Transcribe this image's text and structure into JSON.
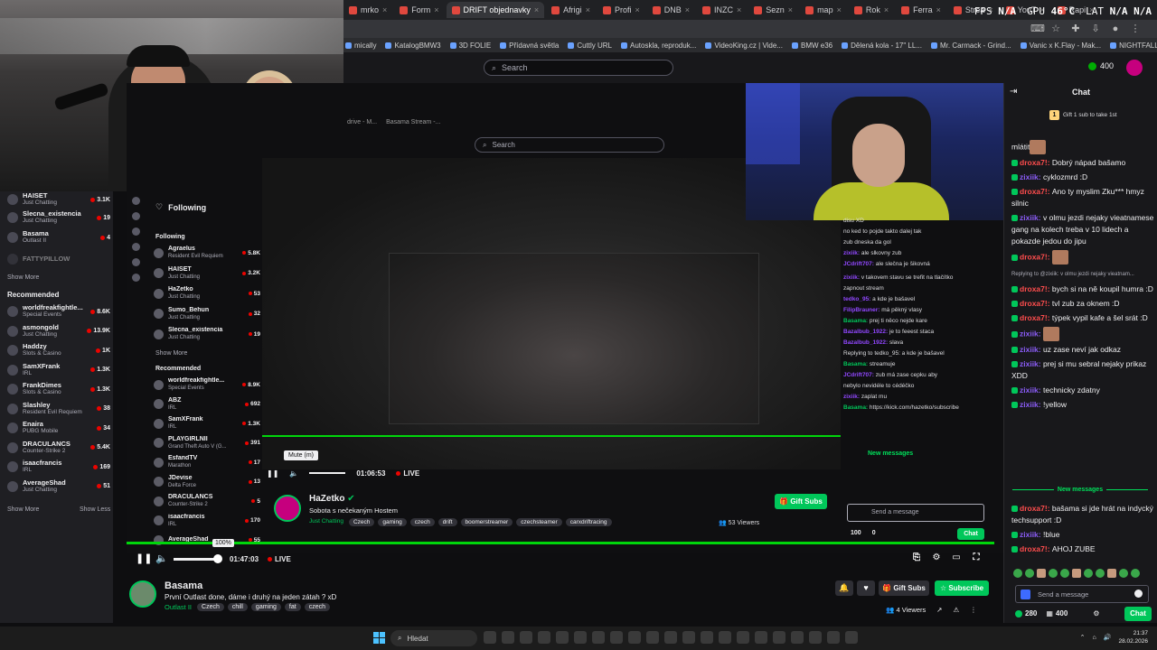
{
  "browser": {
    "tabs": [
      "mrko",
      "Form",
      "DRIFT objednavky",
      "Afrigi",
      "Profi",
      "DNB",
      "INZC",
      "Sezn",
      "map",
      "Rok",
      "Ferra",
      "Strea",
      "YouT",
      "Rapi"
    ],
    "active_tab_index": 2,
    "bookmarks": [
      "mically",
      "KatalogBMW3",
      "3D FOLIE",
      "Přídavná světla",
      "Cuttly URL",
      "Autoskla, reproduk...",
      "VideoKing.cz | Vide...",
      "BMW e36",
      "Dělená kola - 17\" LL...",
      "Mr. Carmack - Grind...",
      "Vanic x K.Flay - Mak...",
      "NIGHTFALL - Jerem..."
    ],
    "all_bookmarks": "Všechny záložky"
  },
  "hud": {
    "fps_label": "FPS",
    "fps_value": "N/A",
    "gpu_label": "GPU",
    "gpu_value": "46°C",
    "lat_label": "LAT",
    "lat_value": "N/A N/A"
  },
  "topnav": {
    "search_placeholder": "Search",
    "points": "400"
  },
  "sidebar": {
    "followed": [
      {
        "name": "HAISET",
        "category": "Just Chatting",
        "viewers": "3.1K"
      },
      {
        "name": "Slecna_existencia",
        "category": "Just Chatting",
        "viewers": "19"
      },
      {
        "name": "Basama",
        "category": "Outlast II",
        "viewers": "4"
      },
      {
        "name": "FATTYPILLOW",
        "category": "",
        "viewers": ""
      }
    ],
    "show_more": "Show More",
    "recommended_heading": "Recommended",
    "recommended": [
      {
        "name": "worldfreakfightle...",
        "category": "Special Events",
        "viewers": "8.6K"
      },
      {
        "name": "asmongold",
        "category": "Just Chatting",
        "viewers": "13.9K"
      },
      {
        "name": "Haddzy",
        "category": "Slots & Casino",
        "viewers": "1K"
      },
      {
        "name": "SamXFrank",
        "category": "IRL",
        "viewers": "1.3K"
      },
      {
        "name": "FrankDimes",
        "category": "Slots & Casino",
        "viewers": "1.3K"
      },
      {
        "name": "Slashley",
        "category": "Resident Evil Requiem",
        "viewers": "38"
      },
      {
        "name": "Enaira",
        "category": "PUBG Mobile",
        "viewers": "34"
      },
      {
        "name": "DRACULANCS",
        "category": "Counter-Strike 2",
        "viewers": "5.4K"
      },
      {
        "name": "isaacfrancis",
        "category": "IRL",
        "viewers": "169"
      },
      {
        "name": "AverageShad",
        "category": "Just Chatting",
        "viewers": "51"
      }
    ],
    "show_more2": "Show More",
    "show_less": "Show Less"
  },
  "inner": {
    "following_label": "Following",
    "following_heading": "Following",
    "followed": [
      {
        "name": "Agraelus",
        "category": "Resident Evil Requiem",
        "viewers": "5.8K"
      },
      {
        "name": "HAISET",
        "category": "Just Chatting",
        "viewers": "3.2K"
      },
      {
        "name": "HaZetko",
        "category": "Just Chatting",
        "viewers": "53"
      },
      {
        "name": "Sumo_Behun",
        "category": "Just Chatting",
        "viewers": "32"
      },
      {
        "name": "Slecna_existencia",
        "category": "Just Chatting",
        "viewers": "19"
      }
    ],
    "show_more": "Show More",
    "recommended_heading": "Recommended",
    "recommended": [
      {
        "name": "worldfreakfightle...",
        "category": "Special Events",
        "viewers": "8.9K"
      },
      {
        "name": "ABZ",
        "category": "IRL",
        "viewers": "692"
      },
      {
        "name": "SamXFrank",
        "category": "IRL",
        "viewers": "1.3K"
      },
      {
        "name": "PLAYGIRLNII",
        "category": "Grand Theft Auto V (G...",
        "viewers": "391"
      },
      {
        "name": "EsfandTV",
        "category": "Marathon",
        "viewers": "17"
      },
      {
        "name": "JDevise",
        "category": "Delta Force",
        "viewers": "13"
      },
      {
        "name": "DRACULANCS",
        "category": "Counter-Strike 2",
        "viewers": "5"
      },
      {
        "name": "isaacfrancis",
        "category": "IRL",
        "viewers": "170"
      },
      {
        "name": "AverageShad",
        "category": "",
        "viewers": "55"
      }
    ],
    "search_placeholder": "Search",
    "tab_text": "drive - M...",
    "tab_text2": "Basama Stream -...",
    "mute_tooltip": "Mute (m)",
    "time": "01:06:53",
    "live": "LIVE",
    "channel_name": "HaZetko",
    "stream_title": "Sobota s nečekaným Hostem",
    "category": "Just Chatting",
    "tags": [
      "Czech",
      "gaming",
      "czech",
      "drift",
      "boomerstreamer",
      "czechsteamer",
      "carxdriftracing"
    ],
    "gift_subs": "Gift Subs",
    "viewers": "53 Viewers",
    "chat_new_messages": "New messages",
    "chat_input_placeholder": "Send a message",
    "chat_points": "100",
    "chat_points2": "0",
    "chat_button": "Chat",
    "chat_lines": [
      {
        "user": "",
        "text": "disu XD"
      },
      {
        "user": "",
        "text": "no ked to pojde takto dalej tak"
      },
      {
        "user": "",
        "text": "zub dneska da gol"
      },
      {
        "user": "zixiik:",
        "text": "ale slkovny zub"
      },
      {
        "user": "JCdrift707:",
        "text": "ale slečna je šikovná"
      },
      {
        "user": "",
        "text": ""
      },
      {
        "user": "zixiik:",
        "text": "v takovem stavu se trefit na tlačítko"
      },
      {
        "user": "",
        "text": "zapnout stream"
      },
      {
        "user": "tedko_95:",
        "text": "a kde je bašavel"
      },
      {
        "user": "FilipBrauner:",
        "text": "má pěkný vlasy"
      },
      {
        "user": "Basama:",
        "text": "prej ti něco nejde kare"
      },
      {
        "user": "Bazalbub_1922:",
        "text": "je to feeest staca"
      },
      {
        "user": "Bazalbub_1922:",
        "text": "slava"
      },
      {
        "user": "",
        "text": "Replying to tedko_95: a kde je bašavel"
      },
      {
        "user": "Basama:",
        "text": "streamuje"
      },
      {
        "user": "JCdrift707:",
        "text": "zub má zase cepku aby"
      },
      {
        "user": "",
        "text": "nebylo nevidéle to cédéčko"
      },
      {
        "user": "zixiik:",
        "text": "zaplat mu"
      },
      {
        "user": "Basama:",
        "text": "https://kick.com/hazetko/subscribe"
      }
    ]
  },
  "player": {
    "volume_tooltip": "100%",
    "time": "01:47:03",
    "live": "LIVE"
  },
  "channel": {
    "name": "Basama",
    "title": "První Outlast done, dáme i druhý na jeden zátah ? xD",
    "category": "Outlast II",
    "tags": [
      "Czech",
      "chill",
      "gaming",
      "fat",
      "czech"
    ],
    "gift_subs": "Gift Subs",
    "subscribe": "Subscribe",
    "viewers": "4 Viewers"
  },
  "chat": {
    "title": "Chat",
    "gift_banner": "Gift 1 sub to take 1st",
    "messages": [
      {
        "user": "",
        "text": "mlátit"
      },
      {
        "user": "droxa7!:",
        "text": "Dobrý nápad bašamo"
      },
      {
        "user": "zixiik:",
        "text": "cyklozmrd :D"
      },
      {
        "user": "droxa7!:",
        "text": "Ano ty myslim Zku*** hmyz silnic"
      },
      {
        "user": "zixiik:",
        "text": "v olmu jezdi nejaky vieatnamese gang na kolech treba v 10 lidech a pokazde jedou do jipu"
      },
      {
        "user": "droxa7!:",
        "text": ""
      },
      {
        "user": "",
        "text": "Replying to @zixiik: v olmu jezdi nejaky vieatnam..."
      },
      {
        "user": "droxa7!:",
        "text": "bych si na ně koupil humra :D"
      },
      {
        "user": "droxa7!:",
        "text": "tvl zub za oknem :D"
      },
      {
        "user": "droxa7!:",
        "text": "týpek vypil kafe a šel srát :D"
      },
      {
        "user": "zixiik:",
        "text": ""
      },
      {
        "user": "zixiik:",
        "text": "uz zase neví jak odkaz"
      },
      {
        "user": "zixiik:",
        "text": "prej si mu sebral nejaky prikaz XDD"
      },
      {
        "user": "zixiik:",
        "text": "technicky zdatny"
      },
      {
        "user": "zixiik:",
        "text": "!yellow"
      }
    ],
    "new_messages": "New messages",
    "messages2": [
      {
        "user": "droxa7!:",
        "text": "bašama si jde hrát na indycký techsupport :D"
      },
      {
        "user": "zixiik:",
        "text": "!blue"
      },
      {
        "user": "droxa7!:",
        "text": "AHOJ ZUBE"
      }
    ],
    "input_placeholder": "Send a message",
    "points": "280",
    "points2": "400",
    "chat_button": "Chat"
  },
  "taskbar": {
    "search": "Hledat",
    "time": "21:37",
    "date": "28.02.2026"
  }
}
